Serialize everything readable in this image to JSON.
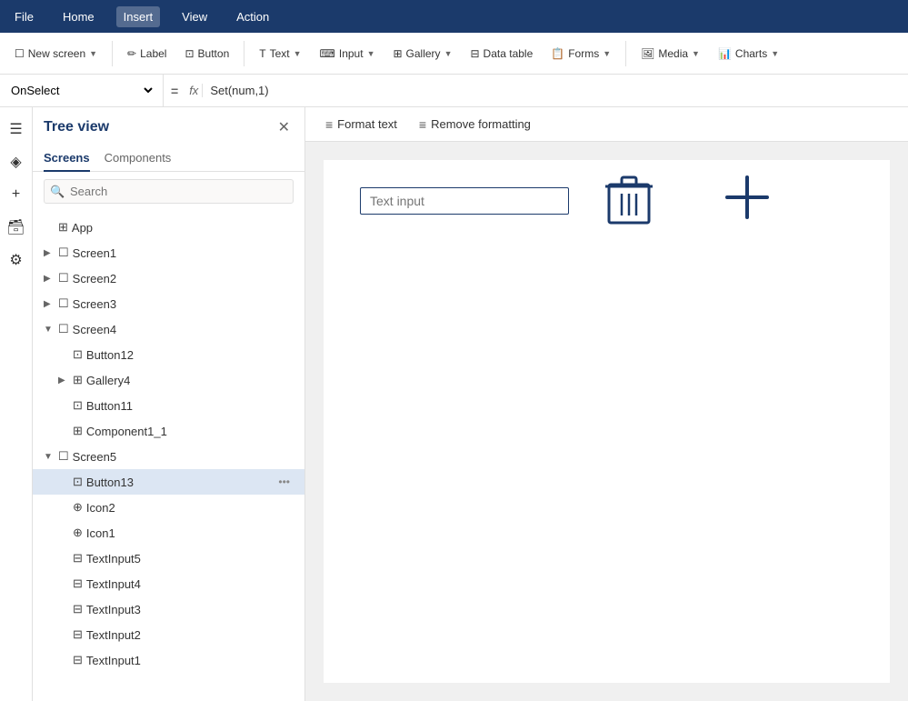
{
  "menubar": {
    "items": [
      "File",
      "Home",
      "Insert",
      "View",
      "Action"
    ],
    "active": "Insert"
  },
  "toolbar": {
    "new_screen_label": "New screen",
    "label_label": "Label",
    "button_label": "Button",
    "text_label": "Text",
    "input_label": "Input",
    "gallery_label": "Gallery",
    "data_table_label": "Data table",
    "forms_label": "Forms",
    "media_label": "Media",
    "charts_label": "Charts"
  },
  "formula_bar": {
    "property": "OnSelect",
    "equals": "=",
    "fx": "fx",
    "formula": "Set(num,1)"
  },
  "tree": {
    "title": "Tree view",
    "tabs": [
      "Screens",
      "Components"
    ],
    "active_tab": "Screens",
    "search_placeholder": "Search",
    "items": [
      {
        "id": "app",
        "label": "App",
        "level": 0,
        "icon": "⊞",
        "chevron": ""
      },
      {
        "id": "screen1",
        "label": "Screen1",
        "level": 0,
        "icon": "☐",
        "chevron": "▶"
      },
      {
        "id": "screen2",
        "label": "Screen2",
        "level": 0,
        "icon": "☐",
        "chevron": "▶"
      },
      {
        "id": "screen3",
        "label": "Screen3",
        "level": 0,
        "icon": "☐",
        "chevron": "▶"
      },
      {
        "id": "screen4",
        "label": "Screen4",
        "level": 0,
        "icon": "☐",
        "chevron": "▼"
      },
      {
        "id": "button12",
        "label": "Button12",
        "level": 1,
        "icon": "⊡",
        "chevron": ""
      },
      {
        "id": "gallery4",
        "label": "Gallery4",
        "level": 1,
        "icon": "⊞",
        "chevron": "▶"
      },
      {
        "id": "button11",
        "label": "Button11",
        "level": 1,
        "icon": "⊡",
        "chevron": ""
      },
      {
        "id": "component1_1",
        "label": "Component1_1",
        "level": 1,
        "icon": "⊞",
        "chevron": ""
      },
      {
        "id": "screen5",
        "label": "Screen5",
        "level": 0,
        "icon": "☐",
        "chevron": "▼"
      },
      {
        "id": "button13",
        "label": "Button13",
        "level": 1,
        "icon": "⊡",
        "chevron": "",
        "selected": true,
        "has_more": true
      },
      {
        "id": "icon2",
        "label": "Icon2",
        "level": 1,
        "icon": "⊕",
        "chevron": ""
      },
      {
        "id": "icon1",
        "label": "Icon1",
        "level": 1,
        "icon": "⊕",
        "chevron": ""
      },
      {
        "id": "textinput5",
        "label": "TextInput5",
        "level": 1,
        "icon": "⊟",
        "chevron": ""
      },
      {
        "id": "textinput4",
        "label": "TextInput4",
        "level": 1,
        "icon": "⊟",
        "chevron": ""
      },
      {
        "id": "textinput3",
        "label": "TextInput3",
        "level": 1,
        "icon": "⊟",
        "chevron": ""
      },
      {
        "id": "textinput2",
        "label": "TextInput2",
        "level": 1,
        "icon": "⊟",
        "chevron": ""
      },
      {
        "id": "textinput1",
        "label": "TextInput1",
        "level": 1,
        "icon": "⊟",
        "chevron": ""
      }
    ]
  },
  "format_toolbar": {
    "format_text": "Format text",
    "remove_formatting": "Remove formatting"
  },
  "canvas": {
    "text_input_placeholder": "Text input",
    "trash_label": "🗑",
    "plus_label": "+"
  }
}
